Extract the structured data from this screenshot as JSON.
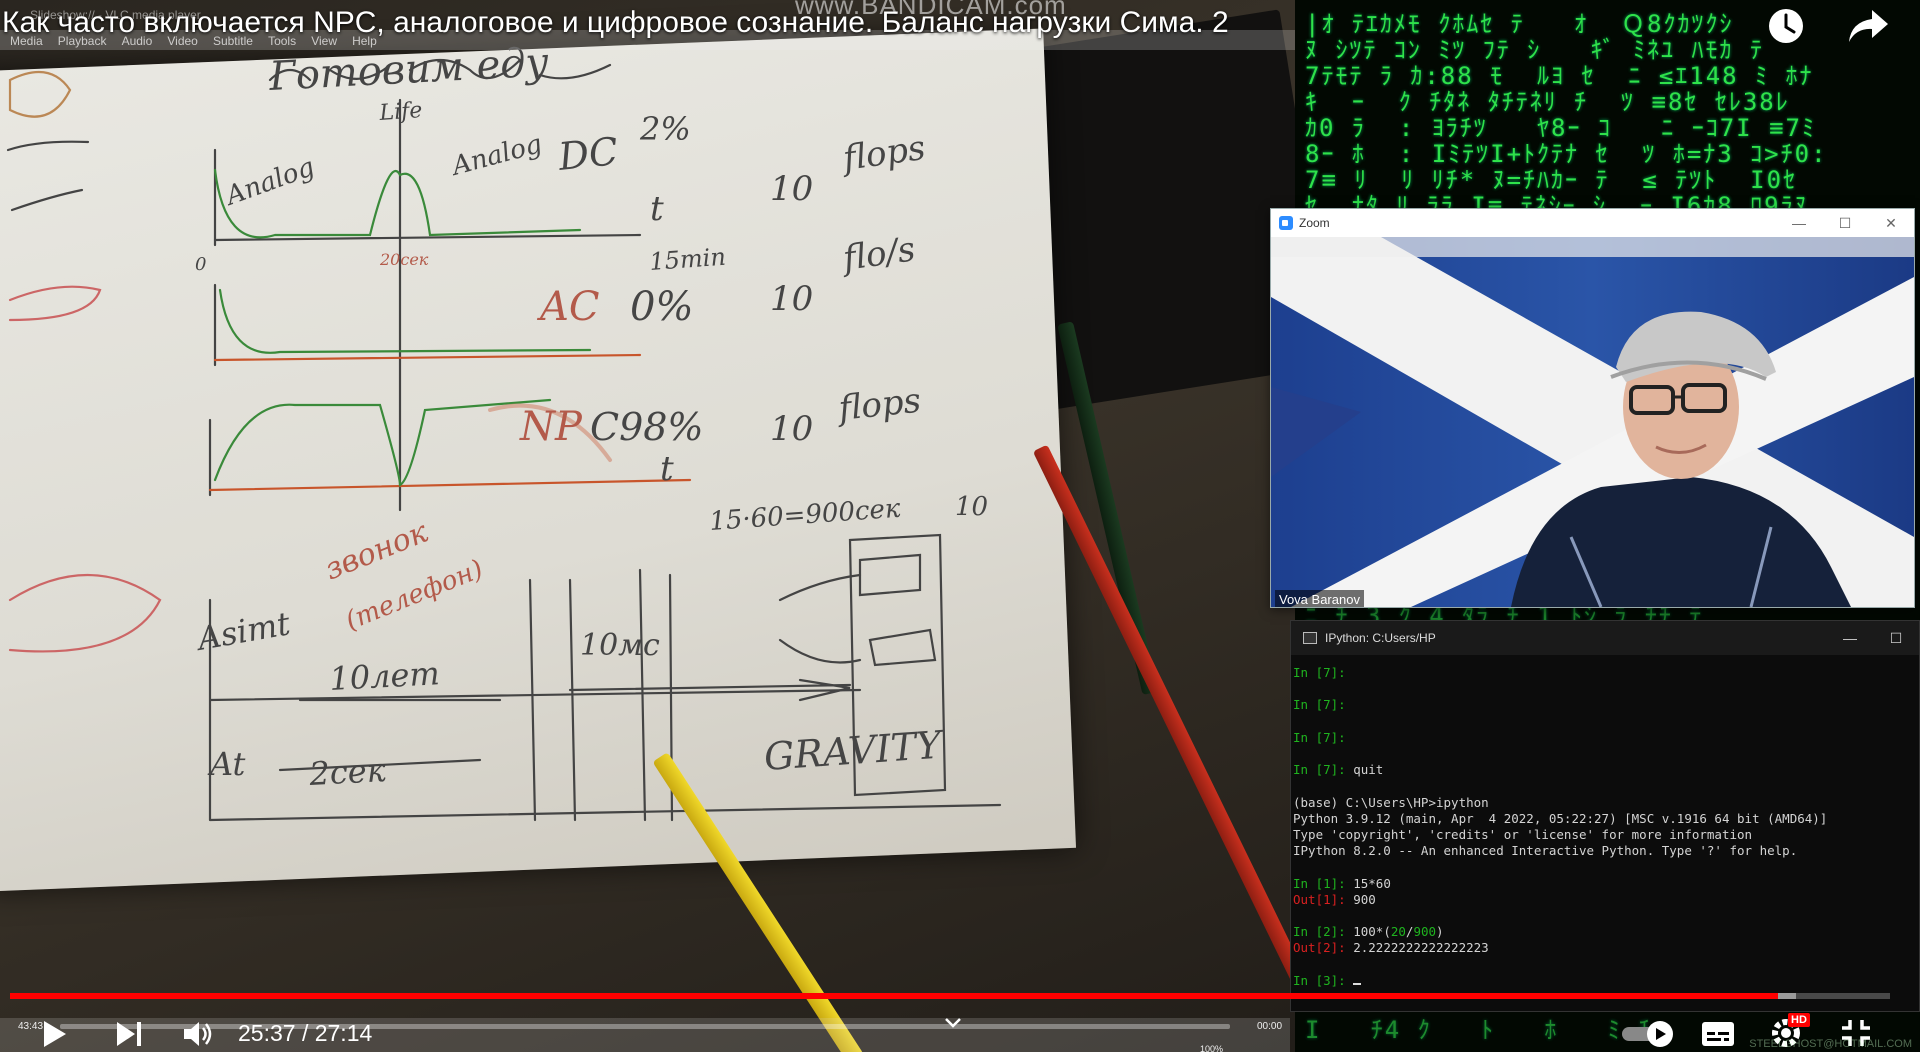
{
  "header": {
    "video_title": "Как часто включается NPC, аналоговое и цифровое сознание. Баланс нагрузки Сима. 2",
    "watermark": "www.BANDICAM.com",
    "vlc_window_title": "Slideshow:// - VLC media player"
  },
  "vlc_menu": [
    "Media",
    "Playback",
    "Audio",
    "Video",
    "Subtitle",
    "Tools",
    "View",
    "Help"
  ],
  "zoom": {
    "window_title": "Zoom",
    "participant_name": "Vova Baranov"
  },
  "terminal": {
    "window_title": "IPython: C:Users/HP"
  },
  "player": {
    "current_time": "25:37",
    "duration": "27:14",
    "time_display": "25:37 / 27:14",
    "played_fraction": 0.9404,
    "buffered_fraction": 0.95,
    "vlc_elapsed": "43:43",
    "vlc_remaining": "00:00",
    "vlc_volume": "100%",
    "hd_badge": "HD"
  },
  "footer": {
    "email_watermark": "STEELGHOST@HOTMAIL.COM"
  },
  "colors": {
    "progress_played": "#ff0000",
    "matrix_green": "#2fe24a",
    "terminal_green": "#1fb31f",
    "terminal_red": "#d92020",
    "zoom_blue": "#2d8cff"
  }
}
